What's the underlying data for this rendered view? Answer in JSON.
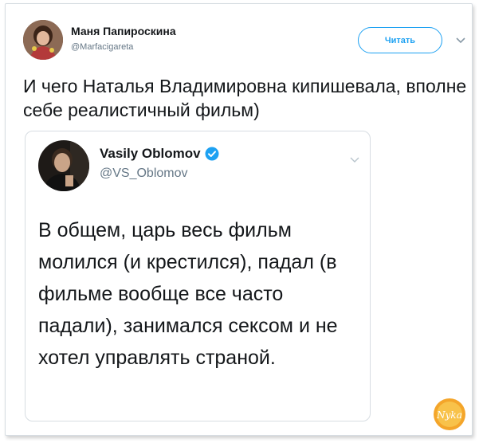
{
  "tweet": {
    "author_name": "Маня Папироскина",
    "author_handle": "@Marfacigareta",
    "follow_label": "Читать",
    "text": "И чего Наталья Владимировна кипишевала, вполне себе реалистичный фильм)"
  },
  "quoted_tweet": {
    "author_name": "Vasily Oblomov",
    "author_handle": "@VS_Oblomov",
    "verified": true,
    "text": "В общем, царь весь фильм молился (и крестился), падал (в фильме вообще все часто падали), занимался сексом и не хотел управлять страной."
  },
  "watermark": {
    "text": "Nyka"
  },
  "colors": {
    "accent": "#1da1f2",
    "text": "#14171a",
    "muted": "#657786",
    "border": "#d7dde2"
  },
  "icons": {
    "verified": "verified-badge-icon",
    "menu": "chevron-down-icon"
  }
}
